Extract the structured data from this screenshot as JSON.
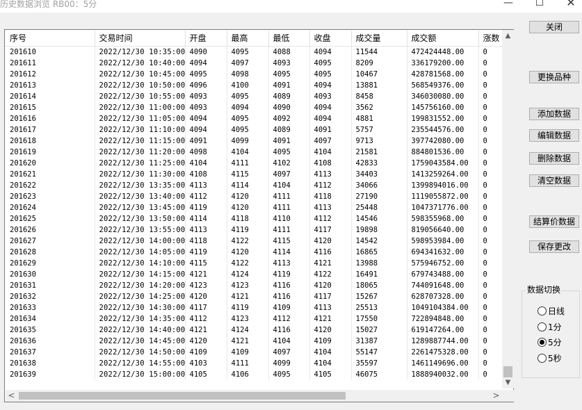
{
  "window": {
    "title": "历史数据浏览 RB00：5分",
    "minimize_glyph": "—",
    "maximize_glyph": "☐",
    "close_glyph": "✕"
  },
  "table": {
    "columns": [
      "序号",
      "交易时间",
      "开盘",
      "最高",
      "最低",
      "收盘",
      "成交量",
      "成交额",
      "涨数"
    ],
    "rows": [
      [
        "201610",
        "2022/12/30 10:35:00",
        "4090",
        "4095",
        "4088",
        "4094",
        "11544",
        "472424448.00",
        "0"
      ],
      [
        "201611",
        "2022/12/30 10:40:00",
        "4094",
        "4097",
        "4093",
        "4095",
        "8209",
        "336179200.00",
        "0"
      ],
      [
        "201612",
        "2022/12/30 10:45:00",
        "4095",
        "4098",
        "4095",
        "4095",
        "10467",
        "428781568.00",
        "0"
      ],
      [
        "201613",
        "2022/12/30 10:50:00",
        "4096",
        "4100",
        "4091",
        "4094",
        "13881",
        "568549376.00",
        "0"
      ],
      [
        "201614",
        "2022/12/30 10:55:00",
        "4093",
        "4095",
        "4089",
        "4093",
        "8458",
        "346030080.00",
        "0"
      ],
      [
        "201615",
        "2022/12/30 11:00:00",
        "4093",
        "4094",
        "4090",
        "4094",
        "3562",
        "145756160.00",
        "0"
      ],
      [
        "201616",
        "2022/12/30 11:05:00",
        "4094",
        "4095",
        "4092",
        "4094",
        "4881",
        "199831552.00",
        "0"
      ],
      [
        "201617",
        "2022/12/30 11:10:00",
        "4094",
        "4095",
        "4089",
        "4091",
        "5757",
        "235544576.00",
        "0"
      ],
      [
        "201618",
        "2022/12/30 11:15:00",
        "4091",
        "4099",
        "4091",
        "4097",
        "9713",
        "397742080.00",
        "0"
      ],
      [
        "201619",
        "2022/12/30 11:20:00",
        "4098",
        "4104",
        "4095",
        "4104",
        "21581",
        "884801536.00",
        "0"
      ],
      [
        "201620",
        "2022/12/30 11:25:00",
        "4104",
        "4111",
        "4102",
        "4108",
        "42833",
        "1759043584.00",
        "0"
      ],
      [
        "201621",
        "2022/12/30 11:30:00",
        "4108",
        "4115",
        "4097",
        "4113",
        "34403",
        "1413259264.00",
        "0"
      ],
      [
        "201622",
        "2022/12/30 13:35:00",
        "4113",
        "4114",
        "4104",
        "4112",
        "34066",
        "1399894016.00",
        "0"
      ],
      [
        "201623",
        "2022/12/30 13:40:00",
        "4112",
        "4120",
        "4111",
        "4118",
        "27190",
        "1119055872.00",
        "0"
      ],
      [
        "201624",
        "2022/12/30 13:45:00",
        "4119",
        "4120",
        "4111",
        "4113",
        "25448",
        "1047371776.00",
        "0"
      ],
      [
        "201625",
        "2022/12/30 13:50:00",
        "4114",
        "4118",
        "4110",
        "4112",
        "14546",
        "598355968.00",
        "0"
      ],
      [
        "201626",
        "2022/12/30 13:55:00",
        "4113",
        "4119",
        "4111",
        "4117",
        "19898",
        "819056640.00",
        "0"
      ],
      [
        "201627",
        "2022/12/30 14:00:00",
        "4118",
        "4122",
        "4115",
        "4120",
        "14542",
        "598953984.00",
        "0"
      ],
      [
        "201628",
        "2022/12/30 14:05:00",
        "4119",
        "4120",
        "4114",
        "4116",
        "16865",
        "694341632.00",
        "0"
      ],
      [
        "201629",
        "2022/12/30 14:10:00",
        "4115",
        "4122",
        "4113",
        "4121",
        "13988",
        "575946752.00",
        "0"
      ],
      [
        "201630",
        "2022/12/30 14:15:00",
        "4121",
        "4124",
        "4119",
        "4122",
        "16491",
        "679743488.00",
        "0"
      ],
      [
        "201631",
        "2022/12/30 14:20:00",
        "4123",
        "4123",
        "4116",
        "4120",
        "18065",
        "744091648.00",
        "0"
      ],
      [
        "201632",
        "2022/12/30 14:25:00",
        "4120",
        "4121",
        "4116",
        "4117",
        "15267",
        "628707328.00",
        "0"
      ],
      [
        "201633",
        "2022/12/30 14:30:00",
        "4117",
        "4119",
        "4109",
        "4113",
        "25513",
        "1049104384.00",
        "0"
      ],
      [
        "201634",
        "2022/12/30 14:35:00",
        "4112",
        "4123",
        "4112",
        "4121",
        "17550",
        "722894848.00",
        "0"
      ],
      [
        "201635",
        "2022/12/30 14:40:00",
        "4121",
        "4124",
        "4116",
        "4120",
        "15027",
        "619147264.00",
        "0"
      ],
      [
        "201636",
        "2022/12/30 14:45:00",
        "4120",
        "4121",
        "4104",
        "4109",
        "31387",
        "1289887744.00",
        "0"
      ],
      [
        "201637",
        "2022/12/30 14:50:00",
        "4109",
        "4109",
        "4097",
        "4104",
        "55147",
        "2261475328.00",
        "0"
      ],
      [
        "201638",
        "2022/12/30 14:55:00",
        "4103",
        "4111",
        "4099",
        "4104",
        "35597",
        "1461149696.00",
        "0"
      ],
      [
        "201639",
        "2022/12/30 15:00:00",
        "4105",
        "4106",
        "4095",
        "4105",
        "46075",
        "1888940032.00",
        "0"
      ]
    ]
  },
  "buttons": {
    "close": "关闭",
    "change_symbol": "更换品种",
    "add_data": "添加数据",
    "edit_data": "编辑数据",
    "delete_data": "删除数据",
    "clear_data": "清空数据",
    "settle_price": "结算价数据",
    "save_changes": "保存更改"
  },
  "data_switch": {
    "label": "数据切换",
    "options": [
      "日线",
      "1分",
      "5分",
      "5秒"
    ],
    "selected": "5分"
  },
  "scroll_glyphs": {
    "up": "▲",
    "down": "▼",
    "left": "<",
    "right": ">"
  }
}
